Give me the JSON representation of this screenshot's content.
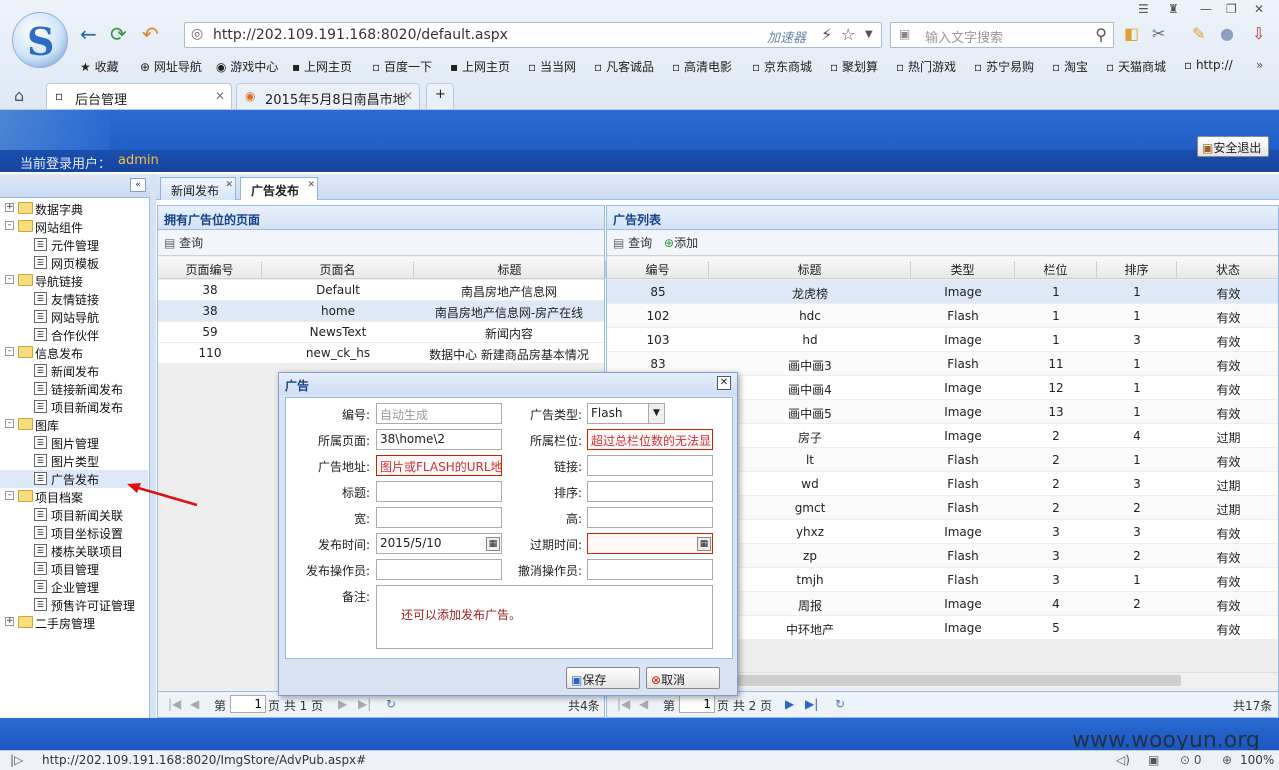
{
  "browser": {
    "url": "http://202.109.191.168:8020/default.aspx",
    "accelerator": "加速器",
    "search_placeholder": "输入文字搜索",
    "favorites": [
      "收藏",
      "网址导航",
      "游戏中心",
      "上网主页",
      "百度一下",
      "上网主页",
      "当当网",
      "凡客诚品",
      "高清电影",
      "京东商城",
      "聚划算",
      "热门游戏",
      "苏宁易购",
      "淘宝",
      "天猫商城",
      "http://"
    ],
    "tabs": [
      {
        "label": "后台管理"
      },
      {
        "label": "2015年5月8日南昌市地"
      }
    ],
    "status_url": "http://202.109.191.168:8020/ImgStore/AdvPub.aspx#",
    "zoom": "100%"
  },
  "app": {
    "login_label": "当前登录用户：",
    "user": "admin",
    "logout": "安全退出"
  },
  "tree": [
    {
      "label": "数据字典",
      "type": "folder",
      "level": 0,
      "exp": "+"
    },
    {
      "label": "网站组件",
      "type": "folder",
      "level": 0,
      "exp": "-"
    },
    {
      "label": "元件管理",
      "type": "leaf",
      "level": 1
    },
    {
      "label": "网页模板",
      "type": "leaf",
      "level": 1
    },
    {
      "label": "导航链接",
      "type": "folder",
      "level": 0,
      "exp": "-"
    },
    {
      "label": "友情链接",
      "type": "leaf",
      "level": 1
    },
    {
      "label": "网站导航",
      "type": "leaf",
      "level": 1
    },
    {
      "label": "合作伙伴",
      "type": "leaf",
      "level": 1
    },
    {
      "label": "信息发布",
      "type": "folder",
      "level": 0,
      "exp": "-"
    },
    {
      "label": "新闻发布",
      "type": "leaf",
      "level": 1
    },
    {
      "label": "链接新闻发布",
      "type": "leaf",
      "level": 1
    },
    {
      "label": "项目新闻发布",
      "type": "leaf",
      "level": 1
    },
    {
      "label": "图库",
      "type": "folder",
      "level": 0,
      "exp": "-"
    },
    {
      "label": "图片管理",
      "type": "leaf",
      "level": 1
    },
    {
      "label": "图片类型",
      "type": "leaf",
      "level": 1
    },
    {
      "label": "广告发布",
      "type": "leaf",
      "level": 1,
      "selected": true
    },
    {
      "label": "项目档案",
      "type": "folder",
      "level": 0,
      "exp": "-"
    },
    {
      "label": "项目新闻关联",
      "type": "leaf",
      "level": 1
    },
    {
      "label": "项目坐标设置",
      "type": "leaf",
      "level": 1
    },
    {
      "label": "楼栋关联项目",
      "type": "leaf",
      "level": 1
    },
    {
      "label": "项目管理",
      "type": "leaf",
      "level": 1
    },
    {
      "label": "企业管理",
      "type": "leaf",
      "level": 1
    },
    {
      "label": "预售许可证管理",
      "type": "leaf",
      "level": 1
    },
    {
      "label": "二手房管理",
      "type": "folder",
      "level": 0,
      "exp": "+"
    }
  ],
  "app_tabs": [
    {
      "label": "新闻发布"
    },
    {
      "label": "广告发布"
    }
  ],
  "pages_panel": {
    "title": "拥有广告位的页面",
    "query": "查询",
    "columns": [
      "页面编号",
      "页面名",
      "标题"
    ],
    "rows": [
      [
        "38",
        "Default",
        "南昌房地产信息网"
      ],
      [
        "38",
        "home",
        "南昌房地产信息网-房产在线"
      ],
      [
        "59",
        "NewsText",
        "新闻内容"
      ],
      [
        "110",
        "new_ck_hs",
        "数据中心 新建商品房基本情况"
      ]
    ],
    "pager": {
      "page_label": "第",
      "page": "1",
      "total_label": "页 共 1 页",
      "count": "共4条"
    }
  },
  "ads_panel": {
    "title": "广告列表",
    "query": "查询",
    "add": "添加",
    "columns": [
      "编号",
      "标题",
      "类型",
      "栏位",
      "排序",
      "状态"
    ],
    "rows": [
      [
        "85",
        "龙虎榜",
        "Image",
        "1",
        "1",
        "有效"
      ],
      [
        "102",
        "hdc",
        "Flash",
        "1",
        "1",
        "有效"
      ],
      [
        "103",
        "hd",
        "Image",
        "1",
        "3",
        "有效"
      ],
      [
        "83",
        "画中画3",
        "Flash",
        "11",
        "1",
        "有效"
      ],
      [
        "",
        "画中画4",
        "Image",
        "12",
        "1",
        "有效"
      ],
      [
        "",
        "画中画5",
        "Image",
        "13",
        "1",
        "有效"
      ],
      [
        "",
        "房子",
        "Image",
        "2",
        "4",
        "过期"
      ],
      [
        "",
        "lt",
        "Flash",
        "2",
        "1",
        "有效"
      ],
      [
        "",
        "wd",
        "Flash",
        "2",
        "3",
        "过期"
      ],
      [
        "",
        "gmct",
        "Flash",
        "2",
        "2",
        "过期"
      ],
      [
        "",
        "yhxz",
        "Image",
        "3",
        "3",
        "有效"
      ],
      [
        "",
        "zp",
        "Flash",
        "3",
        "2",
        "有效"
      ],
      [
        "",
        "tmjh",
        "Flash",
        "3",
        "1",
        "有效"
      ],
      [
        "",
        "周报",
        "Image",
        "4",
        "2",
        "有效"
      ],
      [
        "",
        "中环地产",
        "Image",
        "5",
        "",
        "有效"
      ]
    ],
    "pager": {
      "page_label": "第",
      "page": "1",
      "total_label": "页 共 2 页",
      "count": "共17条"
    }
  },
  "dialog": {
    "title": "广告",
    "fields": {
      "id_label": "编号:",
      "id_placeholder": "自动生成",
      "type_label": "广告类型:",
      "type_value": "Flash",
      "page_label": "所属页面:",
      "page_value": "38\\home\\2",
      "slot_label": "所属栏位:",
      "slot_value": "超过总栏位数的无法显",
      "url_label": "广告地址:",
      "url_value": "图片或FLASH的URL地:",
      "link_label": "链接:",
      "title_label": "标题:",
      "order_label": "排序:",
      "width_label": "宽:",
      "height_label": "高:",
      "pub_label": "发布时间:",
      "pub_value": "2015/5/10",
      "exp_label": "过期时间:",
      "pub_op_label": "发布操作员:",
      "revoke_op_label": "撤消操作员:",
      "remark_label": "备注:",
      "remark_value": "还可以添加发布广告。"
    },
    "save": "保存",
    "cancel": "取消"
  },
  "watermark": "www.wooyun.org"
}
